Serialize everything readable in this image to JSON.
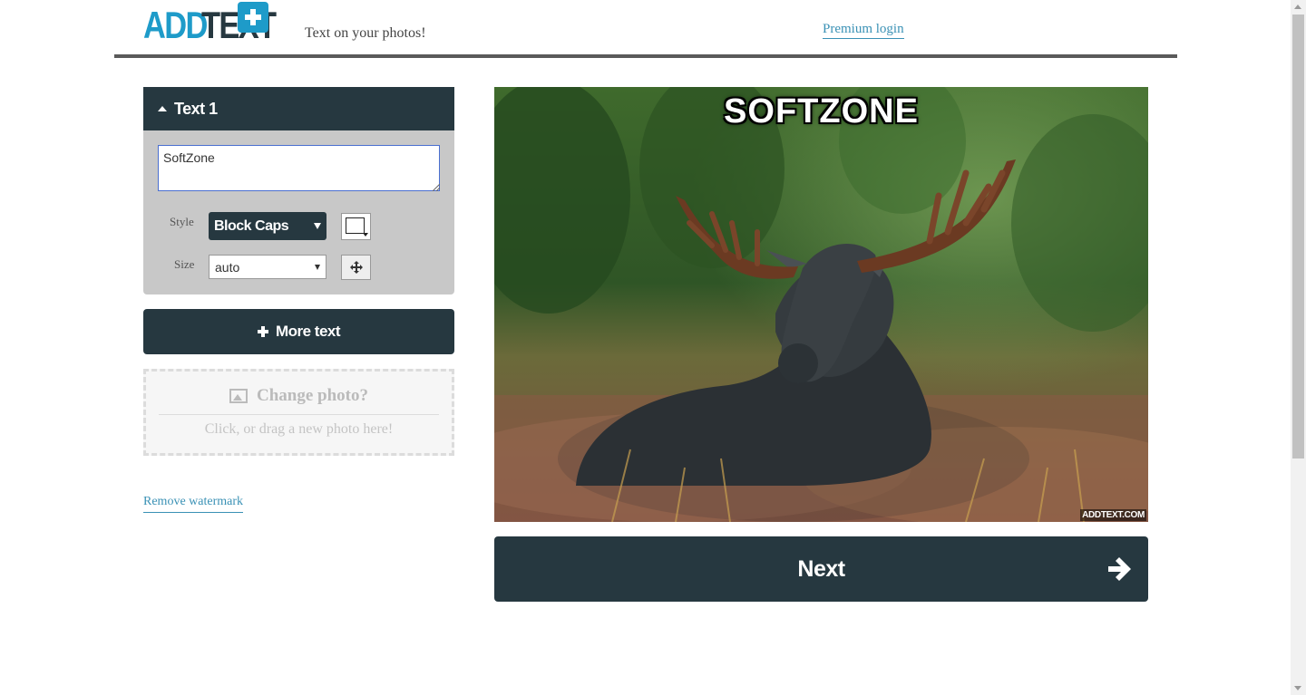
{
  "header": {
    "logo_add": "ADD",
    "logo_text": "TEXT",
    "tagline": "Text on your photos!",
    "premium_login": "Premium login"
  },
  "editor": {
    "text_panel_title": "Text 1",
    "text_value": "SoftZone",
    "style_label": "Style",
    "style_value": "Block Caps",
    "size_label": "Size",
    "size_value": "auto",
    "color_value": "#ffffff",
    "more_text_label": "More text",
    "change_photo_title": "Change photo?",
    "change_photo_sub": "Click, or drag a new photo here!",
    "remove_watermark": "Remove watermark"
  },
  "preview": {
    "overlay_text": "SOFTZONE",
    "watermark": "ADDTEXT.COM",
    "next_label": "Next"
  },
  "colors": {
    "brand_blue": "#1e9bc9",
    "dark": "#263840",
    "link": "#3a91b5"
  },
  "icons": [
    "plus-logo-icon",
    "caret-up-icon",
    "dropdown-arrow-icon",
    "move-icon",
    "plus-icon",
    "image-icon",
    "arrow-right-icon"
  ]
}
